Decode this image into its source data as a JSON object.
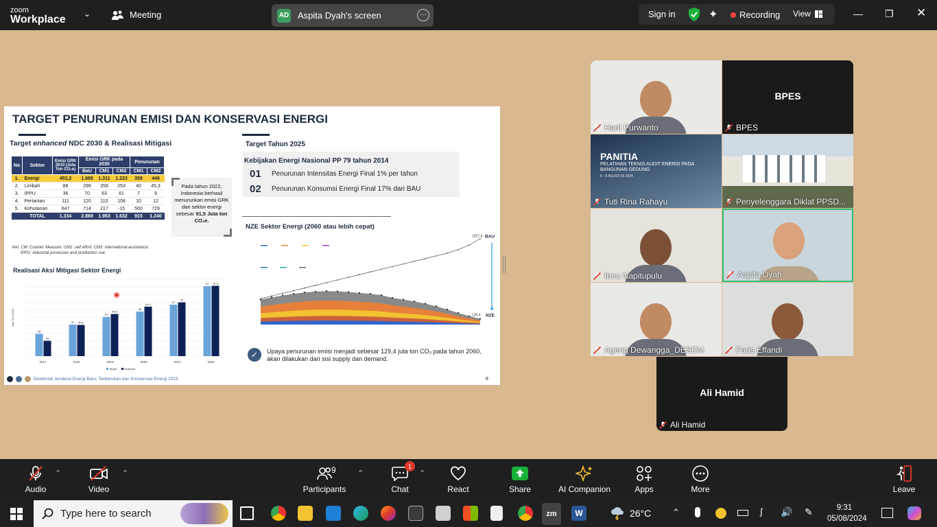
{
  "app": {
    "brand_top": "zoom",
    "brand_bottom": "Workplace",
    "meeting_label": "Meeting"
  },
  "share": {
    "avatar": "AD",
    "label": "Aspita Dyah's screen"
  },
  "topright": {
    "signin": "Sign in",
    "recording": "Recording",
    "view": "View"
  },
  "slide": {
    "title": "TARGET PENURUNAN EMISI DAN KONSERVASI ENERGI",
    "left_heading_a": "Target ",
    "left_heading_em": "enhanced",
    "left_heading_b": " NDC 2030 & Realisasi Mitigasi",
    "table": {
      "headers_top": [
        "No",
        "Sektor",
        "Emisi GRK 2010 (Juta Ton CO₂e)",
        "Emisi GRK pada 2030",
        "Penurunan"
      ],
      "headers_sub": [
        "BaU",
        "CM1",
        "CM2",
        "CM1",
        "CM2"
      ],
      "rows": [
        [
          "1.",
          "Energi",
          "453,2",
          "1.669",
          "1.311",
          "1.223",
          "358",
          "446"
        ],
        [
          "2.",
          "Limbah",
          "88",
          "296",
          "256",
          "253",
          "40",
          "45,3"
        ],
        [
          "3.",
          "IPPU",
          "36",
          "70",
          "63",
          "61",
          "7",
          "9"
        ],
        [
          "4.",
          "Pertanian",
          "111",
          "120",
          "110",
          "108",
          "10",
          "12"
        ],
        [
          "5.",
          "Kehutanan",
          "647",
          "714",
          "217",
          "-15",
          "500",
          "729"
        ]
      ],
      "total": [
        "",
        "TOTAL",
        "1.334",
        "2.869",
        "1.953",
        "1.632",
        "915",
        "1.240"
      ]
    },
    "callout_a": "Pada tahun 2022, Indonesia berhasil menurunkan emisi GRK dari sektor energi sebesar ",
    "callout_b": "91,5 Juta ton CO₂e.",
    "ket_1": "Ket: CM: Counter Measure; CM1: self effort; CM2: international assistance;",
    "ket_2": "IPPU: industrial processes and production use",
    "right_heading": "Target Tahun 2025",
    "policy_title": "Kebijakan Energi Nasional PP 79 tahun 2014",
    "policy_items": [
      {
        "num": "01",
        "text": "Penurunan Intensitas  Energi Final 1% per  tahun"
      },
      {
        "num": "02",
        "text": "Penurunan Konsumsi  Energi Final 17% dari  BAU"
      }
    ],
    "nze_heading": "NZE Sektor Energi (2060 atau lebih cepat)",
    "conclusion": "Upaya penurunan emisi menjadi sebesar 129,4 juta ton CO₂ pada tahun 2060, akan dilakukan dari sisi supply dan demand.",
    "footer": "Direktorat Jenderal Energi Baru, Terbarukan dan Konservasi Energi 2023",
    "page": "8"
  },
  "chart_data": [
    {
      "type": "bar",
      "title": "Realisasi Aksi Mitigasi Sektor Energi",
      "ylabel": "Juta Ton CO2e",
      "categories": [
        "2017",
        "2018",
        "2019",
        "2020",
        "2021",
        "2022"
      ],
      "series": [
        {
          "name": "Target",
          "color": "#6aa3d8",
          "values": [
            29,
            41,
            51,
            58,
            67,
            91
          ]
        },
        {
          "name": "Realisasi",
          "color": "#0d2157",
          "values": [
            20,
            40.6,
            54.8,
            64.4,
            70,
            91.5
          ]
        }
      ],
      "data_labels_target": [
        "29",
        "41",
        "51",
        "58",
        "67",
        "91"
      ],
      "data_labels_realisasi": [
        "20",
        "40,6",
        "54,8",
        "64,4",
        "70",
        "91,5"
      ],
      "ylim": [
        0,
        100
      ],
      "legend": "bottom"
    },
    {
      "type": "area",
      "title": "NZE Sektor Energi (2060 atau lebih cepat)",
      "annotations": {
        "bau_value": "1927,4",
        "bau_label": "BAU",
        "nze_value": "129,4",
        "nze_label": "NZE"
      },
      "bau_line": [
        580,
        640,
        700,
        760,
        820,
        880,
        940,
        1000,
        1060,
        1120,
        1180,
        1240,
        1300,
        1360,
        1420,
        1480,
        1540,
        1600,
        1680,
        1780,
        1927.4
      ],
      "nze_total": [
        560,
        610,
        650,
        690,
        720,
        740,
        750,
        745,
        730,
        710,
        690,
        660,
        600,
        560,
        520,
        470,
        410,
        340,
        260,
        190,
        129.4
      ],
      "ylim": [
        0,
        2000
      ]
    }
  ],
  "gallery": [
    {
      "name": "Hadi Purwanto",
      "type": "video"
    },
    {
      "name": "BPES",
      "type": "name"
    },
    {
      "name": "Tuti Rina Rahayu",
      "type": "poster",
      "poster_title": "PANITIA",
      "poster_sub": "PELATIHAN TEKNIS AUDIT ENERGI PADA BANGUNAN GEDUNG",
      "poster_date": "5 - 8 AGUSTUS 2024"
    },
    {
      "name": "Penyelenggara Diklat PPSD...",
      "type": "building"
    },
    {
      "name": "Ibnu Napitupulu",
      "type": "video"
    },
    {
      "name": "Aspita Dyah",
      "type": "video"
    },
    {
      "name": "Ageng Dewangga_DESDM",
      "type": "video"
    },
    {
      "name": "Faris Effandi",
      "type": "video"
    },
    {
      "name": "Ali Hamid",
      "type": "name"
    }
  ],
  "toolbar": {
    "audio": "Audio",
    "video": "Video",
    "participants": "Participants",
    "participants_count": "9",
    "chat": "Chat",
    "chat_badge": "1",
    "react": "React",
    "share": "Share",
    "ai": "AI Companion",
    "apps": "Apps",
    "more": "More",
    "leave": "Leave"
  },
  "taskbar": {
    "search_placeholder": "Type here to search",
    "temp": "26°C",
    "time": "9:31",
    "date": "05/08/2024"
  },
  "colors": {
    "accent_green": "#1ab13a",
    "active_border": "#2fbf71",
    "recording": "#ff4444",
    "slide_navy": "#1e2a3f",
    "highlight_yellow": "#f6cc3b"
  }
}
